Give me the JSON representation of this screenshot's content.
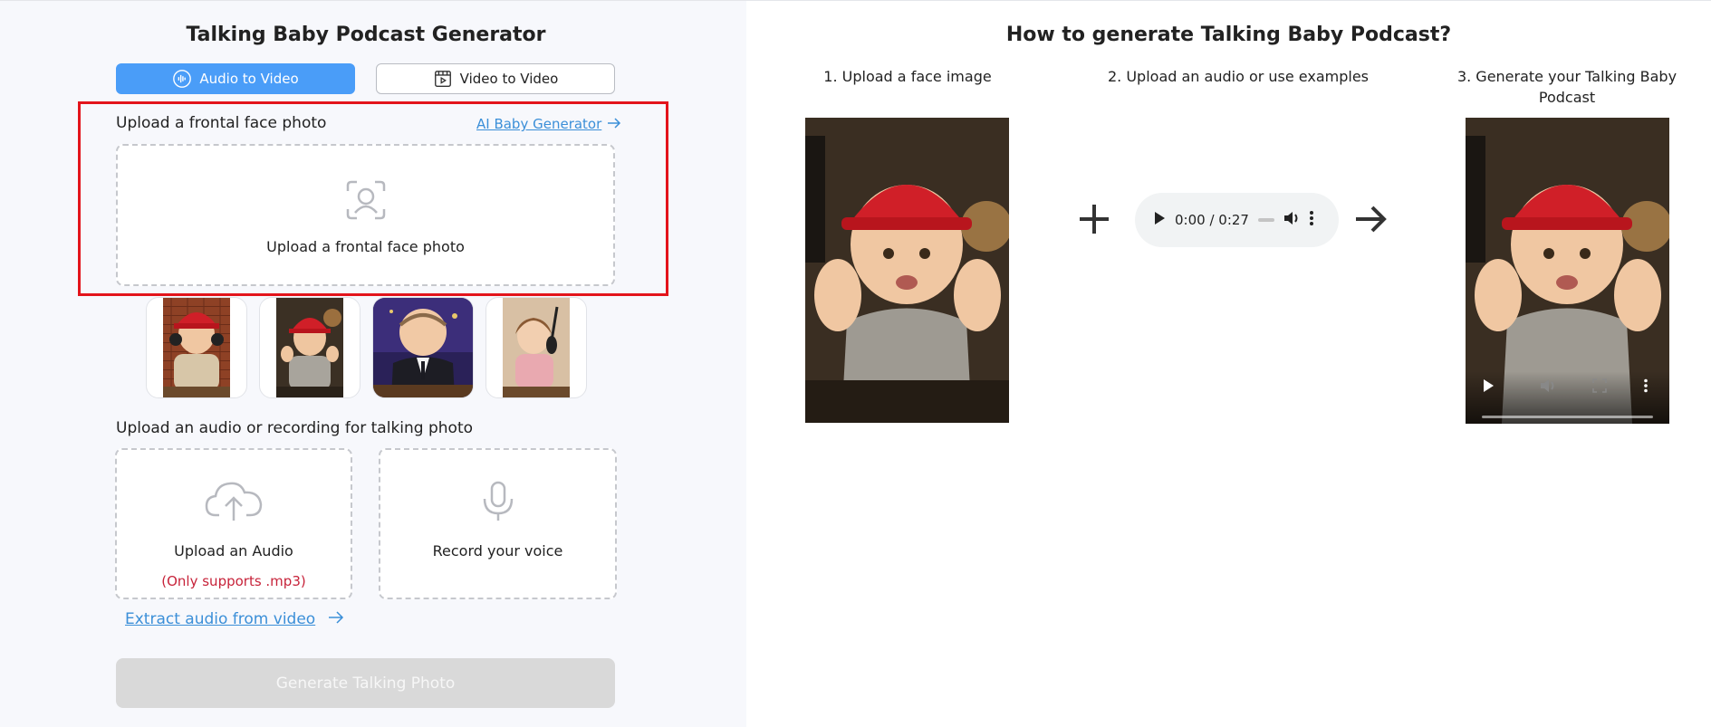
{
  "left_panel": {
    "title": "Talking Baby Podcast Generator",
    "tabs": [
      {
        "label": "Audio to Video",
        "active": true,
        "icon": "soundwave-icon"
      },
      {
        "label": "Video to Video",
        "active": false,
        "icon": "film-icon"
      }
    ],
    "face_section": {
      "label": "Upload a frontal face photo",
      "link_label": "AI Baby Generator",
      "dropzone_text": "Upload a frontal face photo",
      "dropzone_icon": "face-scan-icon"
    },
    "examples": [
      {
        "name": "baby-red-cap-headphones"
      },
      {
        "name": "baby-red-cap-hands-up"
      },
      {
        "name": "baby-suit-talkshow"
      },
      {
        "name": "baby-girl-microphone"
      }
    ],
    "audio_section": {
      "label": "Upload an audio or recording for talking photo",
      "upload_label": "Upload an Audio",
      "upload_hint": "(Only supports .mp3)",
      "record_label": "Record your voice",
      "extract_link": "Extract audio from video"
    },
    "generate_button": "Generate Talking Photo"
  },
  "right_panel": {
    "title": "How to generate Talking Baby Podcast?",
    "steps": [
      {
        "label": "1. Upload a face image"
      },
      {
        "label": "2. Upload an audio or use examples"
      },
      {
        "label": "3. Generate your Talking Baby Podcast"
      }
    ],
    "audio_player": {
      "time": "0:00 / 0:27"
    }
  },
  "colors": {
    "accent": "#4a9df8",
    "link": "#3b8fd8",
    "highlight_box": "#e3141b",
    "error_text": "#c7233a",
    "disabled_button": "#d9d9d9"
  }
}
